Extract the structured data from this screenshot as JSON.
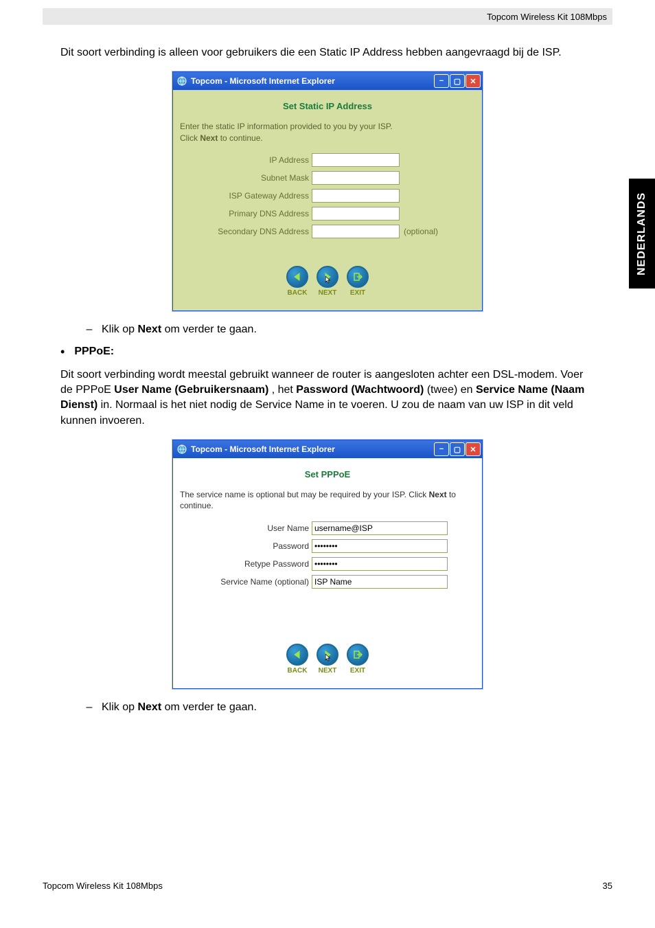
{
  "header_right": "Topcom Wireless Kit 108Mbps",
  "intro": "Dit soort verbinding is alleen voor gebruikers die een Static IP Address hebben aangevraagd bij de ISP.",
  "ie_title": "Topcom - Microsoft Internet Explorer",
  "static": {
    "heading": "Set Static IP Address",
    "instr_a": "Enter the static IP information provided to you by your ISP.",
    "instr_b": "Click ",
    "instr_c": "Next",
    "instr_d": " to continue.",
    "fields": {
      "ip": "IP Address",
      "subnet": "Subnet Mask",
      "gateway": "ISP Gateway Address",
      "pdns": "Primary DNS Address",
      "sdns": "Secondary DNS Address",
      "optional": "(optional)"
    }
  },
  "nav": {
    "back": "BACK",
    "next": "NEXT",
    "exit": "EXIT"
  },
  "click_next_pre": "Klik op ",
  "click_next_bold": "Next",
  "click_next_post": " om verder te gaan.",
  "pppoe_head": "PPPoE:",
  "pppoe_para_a": "Dit soort verbinding wordt meestal gebruikt wanneer de router is aangesloten achter een DSL-modem. Voer de PPPoE ",
  "pppoe_bold1": "User Name (Gebruikersnaam)",
  "pppoe_para_b": " , het ",
  "pppoe_bold2": "Password (Wachtwoord)",
  "pppoe_para_c": " (twee) en ",
  "pppoe_bold3": "Service Name (Naam Dienst)",
  "pppoe_para_d": " in. Normaal is het niet nodig de Service Name in te voeren. U zou de naam van uw ISP in dit veld kunnen invoeren.",
  "pppoe": {
    "heading": "Set PPPoE",
    "instr_a": "The service name is optional but may be required by your ISP. Click ",
    "instr_b": "Next",
    "instr_c": " to continue.",
    "fields": {
      "user": "User Name",
      "user_val": "username@ISP",
      "pass": "Password",
      "pass_val": "••••••••",
      "rpass": "Retype Password",
      "rpass_val": "••••••••",
      "svc": "Service Name (optional)",
      "svc_val": "ISP Name"
    }
  },
  "side_tab": "NEDERLANDS",
  "footer_left": "Topcom Wireless Kit 108Mbps",
  "footer_right": "35"
}
